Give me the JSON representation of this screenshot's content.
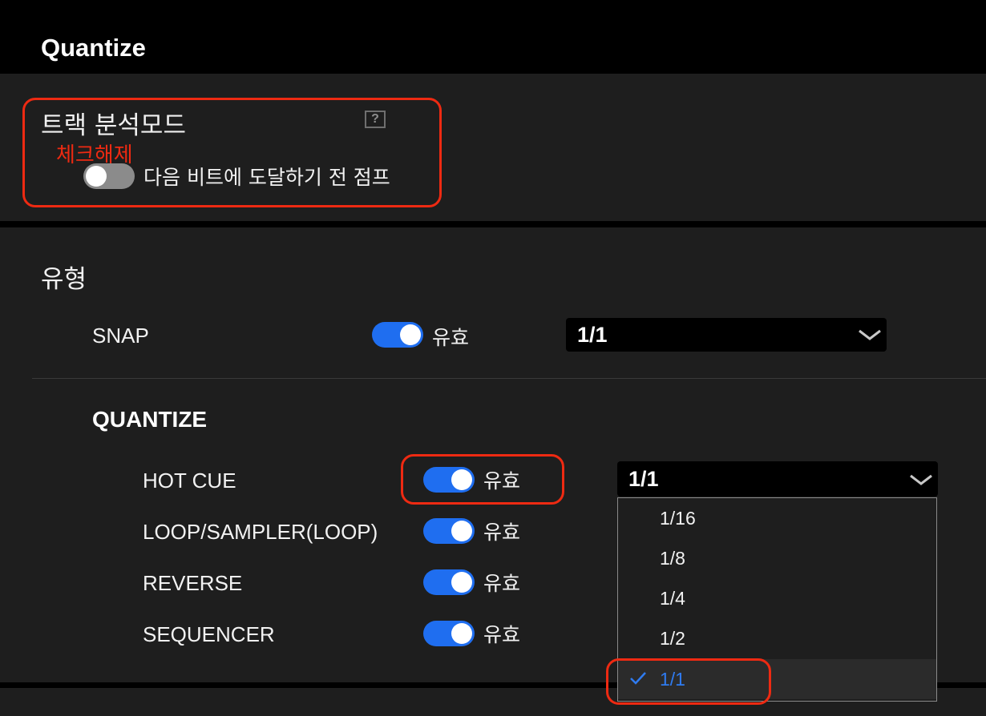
{
  "header": {
    "title": "Quantize"
  },
  "track_analysis": {
    "title": "트랙 분석모드",
    "help_icon": "question-mark-icon",
    "annotation": "체크해제",
    "annotation_color": "#ee2a12",
    "toggle_state": "off",
    "toggle_label": "다음 비트에 도달하기 전 점프"
  },
  "type_section": {
    "title": "유형",
    "snap": {
      "label": "SNAP",
      "toggle_state": "on",
      "toggle_label": "유효",
      "select_value": "1/1"
    }
  },
  "quantize": {
    "title": "QUANTIZE",
    "rows": [
      {
        "label": "HOT CUE",
        "toggle_state": "on",
        "toggle_label": "유효"
      },
      {
        "label": "LOOP/SAMPLER(LOOP)",
        "toggle_state": "on",
        "toggle_label": "유효"
      },
      {
        "label": "REVERSE",
        "toggle_state": "on",
        "toggle_label": "유효"
      },
      {
        "label": "SEQUENCER",
        "toggle_state": "on",
        "toggle_label": "유효"
      }
    ],
    "select_value": "1/1",
    "dropdown_options": [
      "1/16",
      "1/8",
      "1/4",
      "1/2",
      "1/1"
    ],
    "selected_option": "1/1"
  },
  "colors": {
    "accent": "#1f6ef0",
    "selected_text": "#2f7bf0",
    "annotation": "#ee2a12"
  }
}
